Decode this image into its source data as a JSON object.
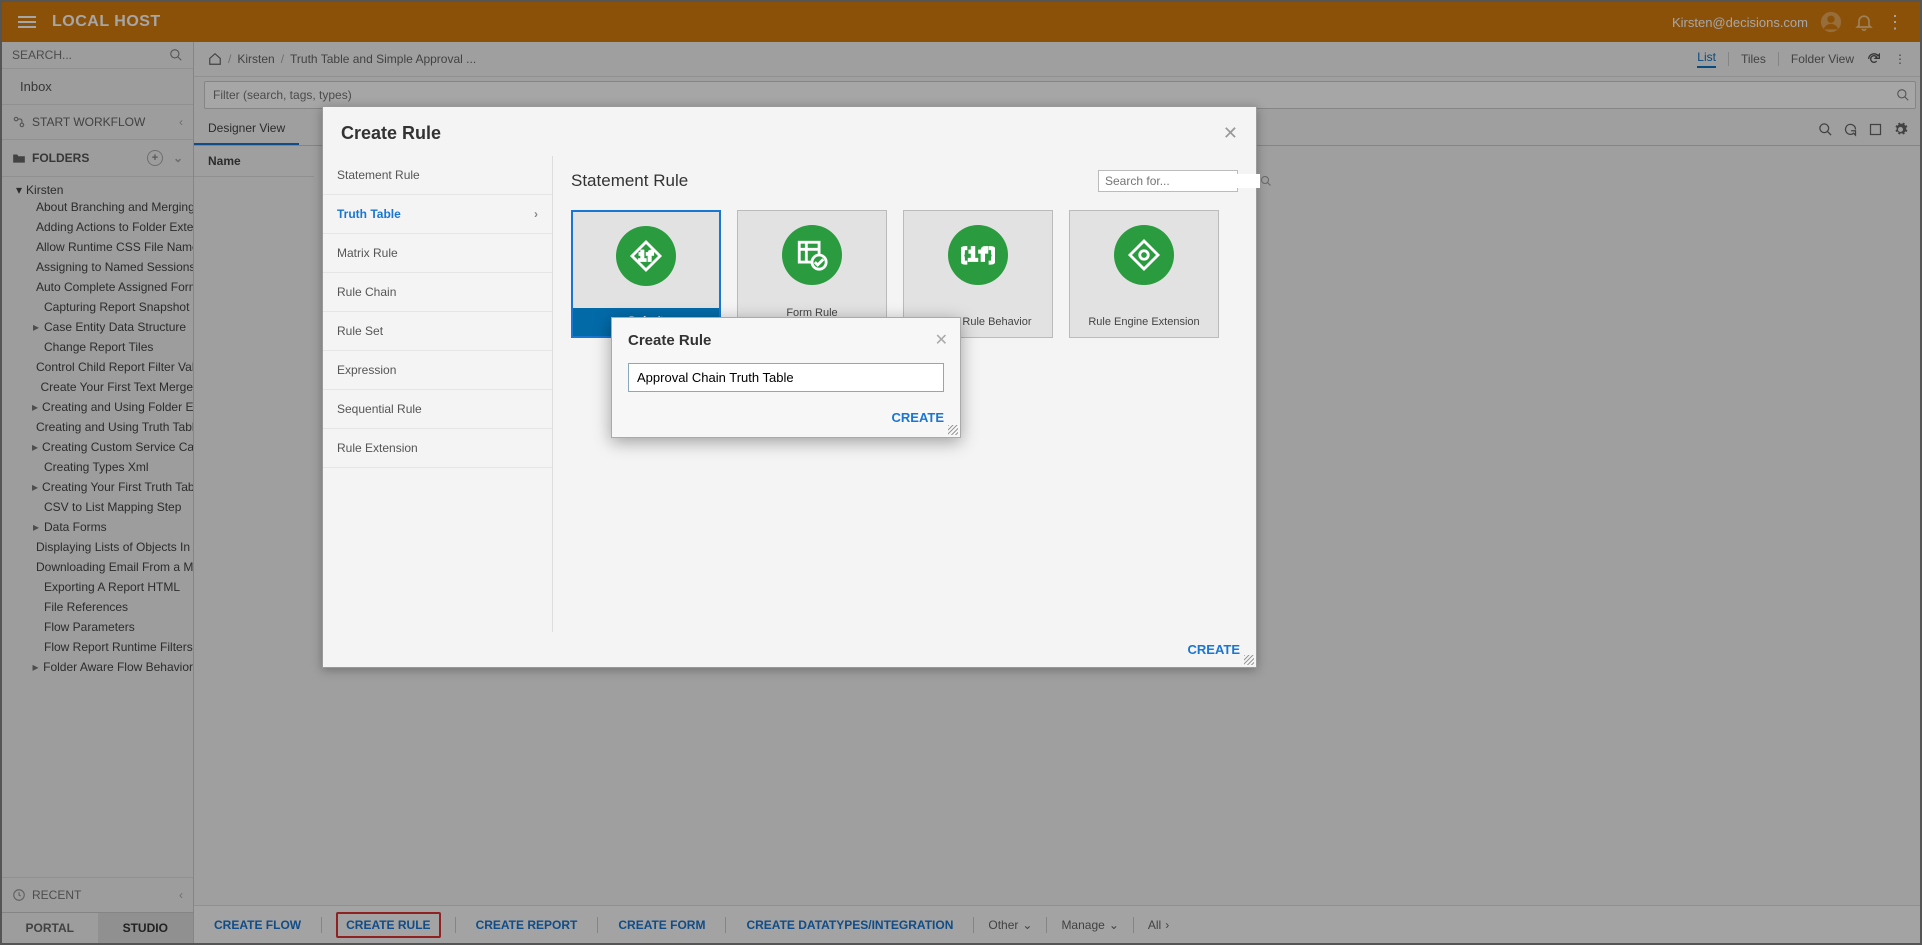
{
  "header": {
    "logo": "LOCAL HOST",
    "user_email": "Kirsten@decisions.com"
  },
  "sidebar": {
    "search_placeholder": "SEARCH...",
    "inbox": "Inbox",
    "start_workflow": "START WORKFLOW",
    "folders_label": "FOLDERS",
    "root": "Kirsten",
    "items": [
      {
        "label": "About Branching and Merging Fl",
        "expandable": false
      },
      {
        "label": "Adding Actions to Folder Extens",
        "expandable": false
      },
      {
        "label": "Allow Runtime CSS File Name",
        "expandable": false
      },
      {
        "label": "Assigning to Named Sessions",
        "expandable": false
      },
      {
        "label": "Auto Complete Assigned Form",
        "expandable": false
      },
      {
        "label": "Capturing Report Snapshot",
        "expandable": false
      },
      {
        "label": "Case Entity Data Structure",
        "expandable": true
      },
      {
        "label": "Change Report Tiles",
        "expandable": false
      },
      {
        "label": "Control Child Report Filter Value",
        "expandable": false
      },
      {
        "label": "Create Your First Text Merge",
        "expandable": false
      },
      {
        "label": "Creating and Using Folder Exten",
        "expandable": true
      },
      {
        "label": "Creating and Using Truth Tables",
        "expandable": false
      },
      {
        "label": "Creating Custom Service Catalo",
        "expandable": true
      },
      {
        "label": "Creating Types Xml",
        "expandable": false
      },
      {
        "label": "Creating Your First Truth Table",
        "expandable": true
      },
      {
        "label": "CSV to List Mapping Step",
        "expandable": false
      },
      {
        "label": "Data Forms",
        "expandable": true
      },
      {
        "label": "Displaying Lists of Objects In A",
        "expandable": false
      },
      {
        "label": "Downloading Email From a Mail",
        "expandable": false
      },
      {
        "label": "Exporting A Report HTML",
        "expandable": false
      },
      {
        "label": "File References",
        "expandable": false
      },
      {
        "label": "Flow Parameters",
        "expandable": false
      },
      {
        "label": "Flow Report Runtime Filters",
        "expandable": false
      },
      {
        "label": "Folder Aware Flow Behavior",
        "expandable": true
      }
    ],
    "recent": "RECENT",
    "tabs": {
      "portal": "PORTAL",
      "studio": "STUDIO"
    }
  },
  "breadcrumb": {
    "home": "⌂",
    "crumb1": "Kirsten",
    "crumb2": "Truth Table and Simple Approval ..."
  },
  "view_switch": {
    "list": "List",
    "tiles": "Tiles",
    "folder": "Folder View"
  },
  "filter_placeholder": "Filter (search, tags, types)",
  "designer_tab": "Designer View",
  "name_col": "Name",
  "bottom_actions": {
    "create_flow": "CREATE FLOW",
    "create_rule": "CREATE RULE",
    "create_report": "CREATE REPORT",
    "create_form": "CREATE FORM",
    "create_datatypes": "CREATE DATATYPES/INTEGRATION",
    "other": "Other",
    "manage": "Manage",
    "all": "All"
  },
  "large_dialog": {
    "title": "Create Rule",
    "nav": [
      "Statement Rule",
      "Truth Table",
      "Matrix Rule",
      "Rule Chain",
      "Rule Set",
      "Expression",
      "Sequential Rule",
      "Rule Extension"
    ],
    "main_title": "Statement Rule",
    "search_placeholder": "Search for...",
    "templates": [
      {
        "label": "Default"
      },
      {
        "label": "Form Rule [Validation/Visibility]"
      },
      {
        "label": "Default Rule Behavior"
      },
      {
        "label": "Rule Engine Extension"
      }
    ],
    "create": "CREATE"
  },
  "small_dialog": {
    "title": "Create Rule",
    "value": "Approval Chain Truth Table",
    "create": "CREATE"
  }
}
